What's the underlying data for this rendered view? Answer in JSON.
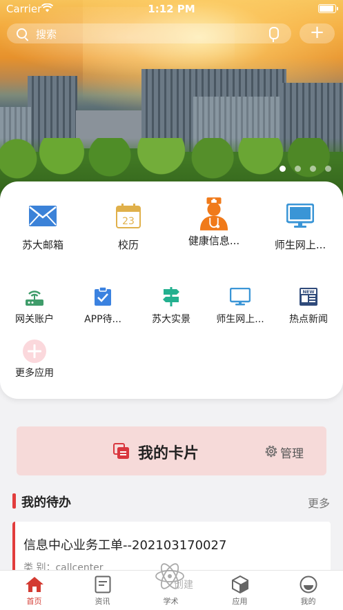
{
  "status_bar": {
    "carrier": "Carrier",
    "time": "1:12 PM"
  },
  "search": {
    "placeholder": "搜索",
    "add_label": "+"
  },
  "banner": {
    "pages": 4,
    "active_page": 1
  },
  "apps": {
    "featured": [
      {
        "label": "苏大邮箱",
        "icon": "mail-icon",
        "color": "#3b82d8"
      },
      {
        "label": "校历",
        "icon": "calendar-icon",
        "color": "#e0b04a",
        "calendar_day": "23"
      },
      {
        "label": "健康信息...",
        "icon": "doctor-icon",
        "color": "#f07a1a"
      },
      {
        "label": "师生网上...",
        "icon": "monitor-icon",
        "color": "#3a95d6"
      }
    ],
    "more": [
      {
        "label": "网关账户",
        "icon": "router-icon",
        "color": "#3f9c6a"
      },
      {
        "label": "APP待...",
        "icon": "clipboard-check-icon",
        "color": "#3b82e0"
      },
      {
        "label": "苏大实景",
        "icon": "signpost-icon",
        "color": "#23b08f"
      },
      {
        "label": "师生网上...",
        "icon": "monitor-icon",
        "color": "#3a95d6"
      },
      {
        "label": "热点新闻",
        "icon": "newspaper-icon",
        "color": "#2f4a7a",
        "badge_text": "NEW"
      }
    ],
    "more_apps_label": "更多应用"
  },
  "my_card": {
    "title": "我的卡片",
    "manage_label": "管理",
    "accent": "#d9363e"
  },
  "todo": {
    "section_title": "我的待办",
    "more_label": "更多",
    "items": [
      {
        "title": "信息中心业务工单--202103170027",
        "kind": "类    别：callcenter"
      }
    ]
  },
  "watermark": {
    "text": "创建"
  },
  "tabs": [
    {
      "label": "首页",
      "icon": "home-icon",
      "active": true
    },
    {
      "label": "资讯",
      "icon": "news-icon",
      "active": false
    },
    {
      "label": "学术",
      "icon": "academic-icon",
      "active": false
    },
    {
      "label": "应用",
      "icon": "cube-icon",
      "active": false
    },
    {
      "label": "我的",
      "icon": "profile-icon",
      "active": false
    }
  ],
  "colors": {
    "accent": "#d33a31",
    "card_bg": "#f6dad9"
  }
}
